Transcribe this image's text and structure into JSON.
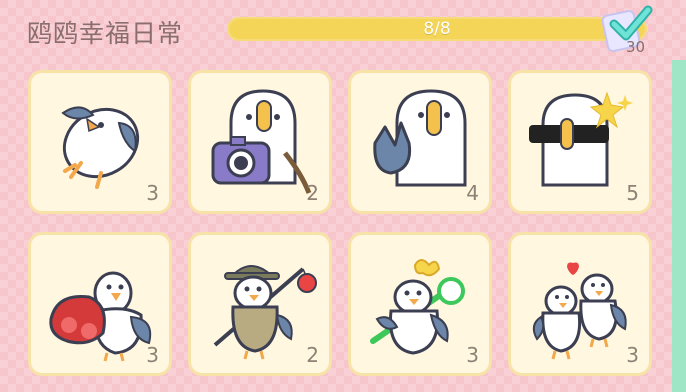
{
  "header": {
    "title": "鸥鸥幸福日常",
    "progress_text": "8/8",
    "progress_value": 1.0,
    "badge_count": "30"
  },
  "colors": {
    "background": "#f6c6cc",
    "card_bg": "#fff7df",
    "card_border": "#f7e2a7",
    "progress_fill": "#f4d557",
    "check": "#4fd1c5"
  },
  "cards": [
    {
      "name": "card-gull-tumble",
      "icon": "gull-tumble-icon",
      "count": "3"
    },
    {
      "name": "card-gull-camera",
      "icon": "gull-camera-icon",
      "count": "2"
    },
    {
      "name": "card-gull-peace",
      "icon": "gull-peace-sign-icon",
      "count": "4"
    },
    {
      "name": "card-gull-sunglasses",
      "icon": "gull-sunglasses-icon",
      "count": "5"
    },
    {
      "name": "card-gull-bag",
      "icon": "gull-red-bag-icon",
      "count": "3"
    },
    {
      "name": "card-gull-fishing",
      "icon": "gull-fishing-icon",
      "count": "2"
    },
    {
      "name": "card-gull-flower",
      "icon": "gull-flower-icon",
      "count": "3"
    },
    {
      "name": "card-gull-couple",
      "icon": "gull-couple-icon",
      "count": "3"
    }
  ]
}
